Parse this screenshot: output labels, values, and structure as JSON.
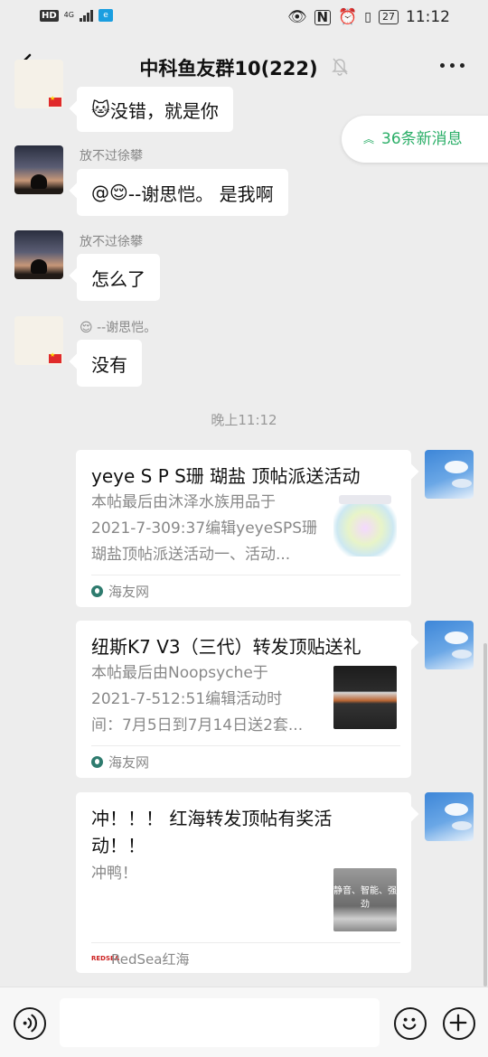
{
  "status_bar": {
    "left_badge": "HD",
    "network": "4G",
    "time": "11:12",
    "battery": "27"
  },
  "header": {
    "title": "中科鱼友群10(222)"
  },
  "new_messages": {
    "label": "36条新消息"
  },
  "messages": [
    {
      "sender": "",
      "text": "没错，就是你",
      "emoji": "🐱"
    },
    {
      "sender": "放不过徐攀",
      "text": "--谢思恺。 是我啊",
      "prefix": "@",
      "emoji": "😌"
    },
    {
      "sender": "放不过徐攀",
      "text": "怎么了"
    },
    {
      "sender": "--谢思恺。",
      "sender_emoji": "😌",
      "text": "没有"
    }
  ],
  "time_divider": "晚上11:12",
  "link_cards": [
    {
      "title": "yeye S P S珊 瑚盐 顶帖派送活动",
      "desc_line1": "本帖最后由沐泽水族用品于",
      "desc_line2": "2021-7-309:37编辑yeyeSPS珊",
      "desc_line3": "瑚盐顶帖派送活动一、活动...",
      "source": "海友网"
    },
    {
      "title": "纽斯K7 V3（三代）转发顶贴送礼",
      "desc_line1": "本帖最后由Noopsyche于",
      "desc_line2": "2021-7-512:51编辑活动时",
      "desc_line3": "间：7月5日到7月14日送2套...",
      "source": "海友网"
    },
    {
      "title_line1": "冲！！！ 红海转发顶帖有奖活",
      "title_line2": "动！！",
      "desc_line1": "冲鸭！",
      "thumb_text": "静音、智能、强劲",
      "source_badge": "REDSEA",
      "source": "RedSea红海"
    }
  ]
}
